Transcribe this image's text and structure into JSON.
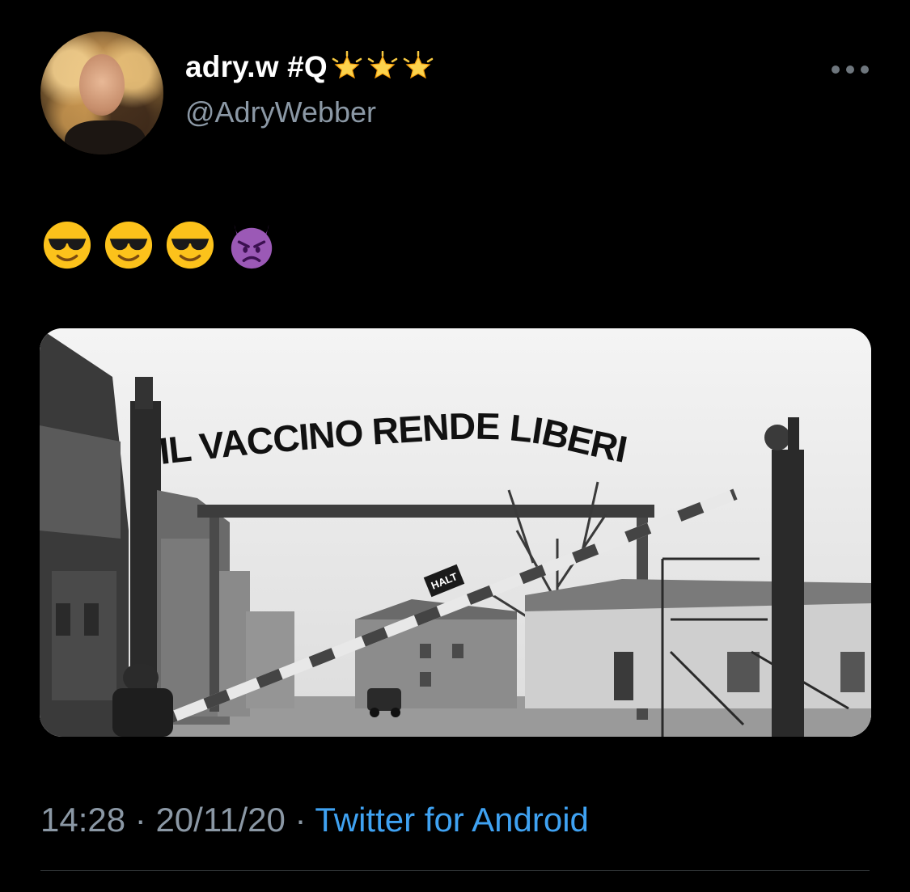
{
  "tweet": {
    "display_name": "adry.w #Q",
    "handle": "@AdryWebber",
    "badge_icons": [
      "glowing-star-icon",
      "glowing-star-icon",
      "glowing-star-icon"
    ],
    "text_emojis": [
      "smiling-face-with-sunglasses",
      "smiling-face-with-sunglasses",
      "smiling-face-with-sunglasses",
      "angry-face-with-horns"
    ],
    "media": {
      "sign_text": "IL VACCINO RENDE LIBERI",
      "halt_sign": "HALT"
    },
    "time": "14:28",
    "separator": "·",
    "date": "20/11/20",
    "source": "Twitter for Android"
  },
  "colors": {
    "background": "#000000",
    "secondary_text": "#8b98a5",
    "link": "#3fa2f2",
    "divider": "#2f3336"
  }
}
